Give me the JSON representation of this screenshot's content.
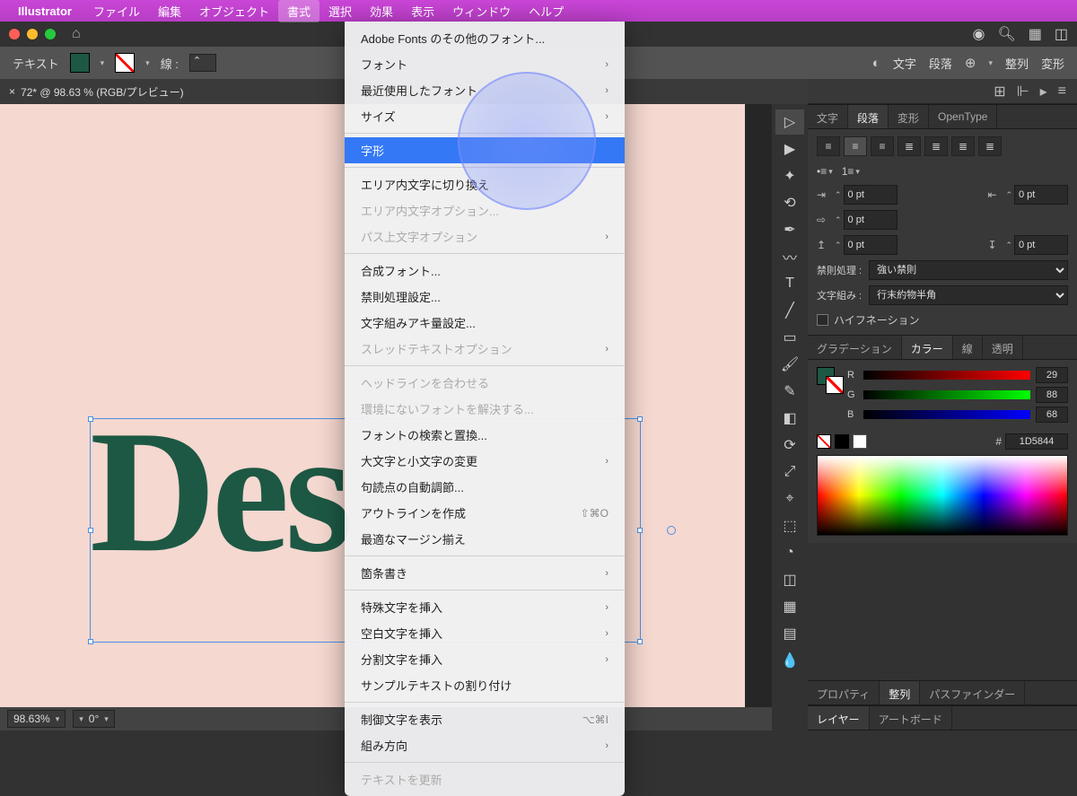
{
  "menubar": {
    "app": "Illustrator",
    "items": [
      "ファイル",
      "編集",
      "オブジェクト",
      "書式",
      "選択",
      "効果",
      "表示",
      "ウィンドウ",
      "ヘルプ"
    ],
    "active_index": 3
  },
  "control_bar": {
    "label": "テキスト",
    "stroke_label": "線 :",
    "right_items": [
      "文字",
      "段落",
      "整列",
      "変形"
    ]
  },
  "doc_tab": "72* @ 98.63 % (RGB/プレビュー)",
  "dropdown": {
    "groups": [
      [
        {
          "label": "Adobe Fonts のその他のフォント...",
          "arrow": false
        },
        {
          "label": "フォント",
          "arrow": true
        },
        {
          "label": "最近使用したフォント",
          "arrow": true
        },
        {
          "label": "サイズ",
          "arrow": true
        }
      ],
      [
        {
          "label": "字形",
          "highlighted": true
        }
      ],
      [
        {
          "label": "エリア内文字に切り換え"
        },
        {
          "label": "エリア内文字オプション...",
          "disabled": true
        },
        {
          "label": "パス上文字オプション",
          "arrow": true,
          "disabled": true
        }
      ],
      [
        {
          "label": "合成フォント..."
        },
        {
          "label": "禁則処理設定..."
        },
        {
          "label": "文字組みアキ量設定..."
        },
        {
          "label": "スレッドテキストオプション",
          "arrow": true,
          "disabled": true
        }
      ],
      [
        {
          "label": "ヘッドラインを合わせる",
          "disabled": true
        },
        {
          "label": "環境にないフォントを解決する...",
          "disabled": true
        },
        {
          "label": "フォントの検索と置換..."
        },
        {
          "label": "大文字と小文字の変更",
          "arrow": true
        },
        {
          "label": "句読点の自動調節..."
        },
        {
          "label": "アウトラインを作成",
          "shortcut": "⇧⌘O"
        },
        {
          "label": "最適なマージン揃え"
        }
      ],
      [
        {
          "label": "箇条書き",
          "arrow": true
        }
      ],
      [
        {
          "label": "特殊文字を挿入",
          "arrow": true
        },
        {
          "label": "空白文字を挿入",
          "arrow": true
        },
        {
          "label": "分割文字を挿入",
          "arrow": true
        },
        {
          "label": "サンプルテキストの割り付け"
        }
      ],
      [
        {
          "label": "制御文字を表示",
          "shortcut": "⌥⌘I"
        },
        {
          "label": "組み方向",
          "arrow": true
        }
      ],
      [
        {
          "label": "テキストを更新",
          "disabled": true
        }
      ]
    ]
  },
  "canvas": {
    "text": "Des"
  },
  "panels": {
    "top_tabs": [
      "文字",
      "段落",
      "変形",
      "OpenType"
    ],
    "top_active": 1,
    "paragraph": {
      "indent_left": "0 pt",
      "indent_right": "0 pt",
      "first_line": "0 pt",
      "space_before": "0 pt",
      "space_after": "0 pt",
      "kinsoku_label": "禁則処理 :",
      "kinsoku_value": "強い禁則",
      "mojikumi_label": "文字組み :",
      "mojikumi_value": "行末約物半角",
      "hyphenation": "ハイフネーション"
    },
    "color_tabs": [
      "グラデーション",
      "カラー",
      "線",
      "透明"
    ],
    "color_active": 1,
    "color": {
      "r": "29",
      "g": "88",
      "b": "68",
      "hex": "1D5844"
    },
    "align_tabs": [
      "プロパティ",
      "整列",
      "パスファインダー"
    ],
    "align_active": 1,
    "layer_tabs": [
      "レイヤー",
      "アートボード"
    ],
    "layer_active": 0
  },
  "statusbar": {
    "zoom": "98.63%",
    "rotation": "0°"
  }
}
